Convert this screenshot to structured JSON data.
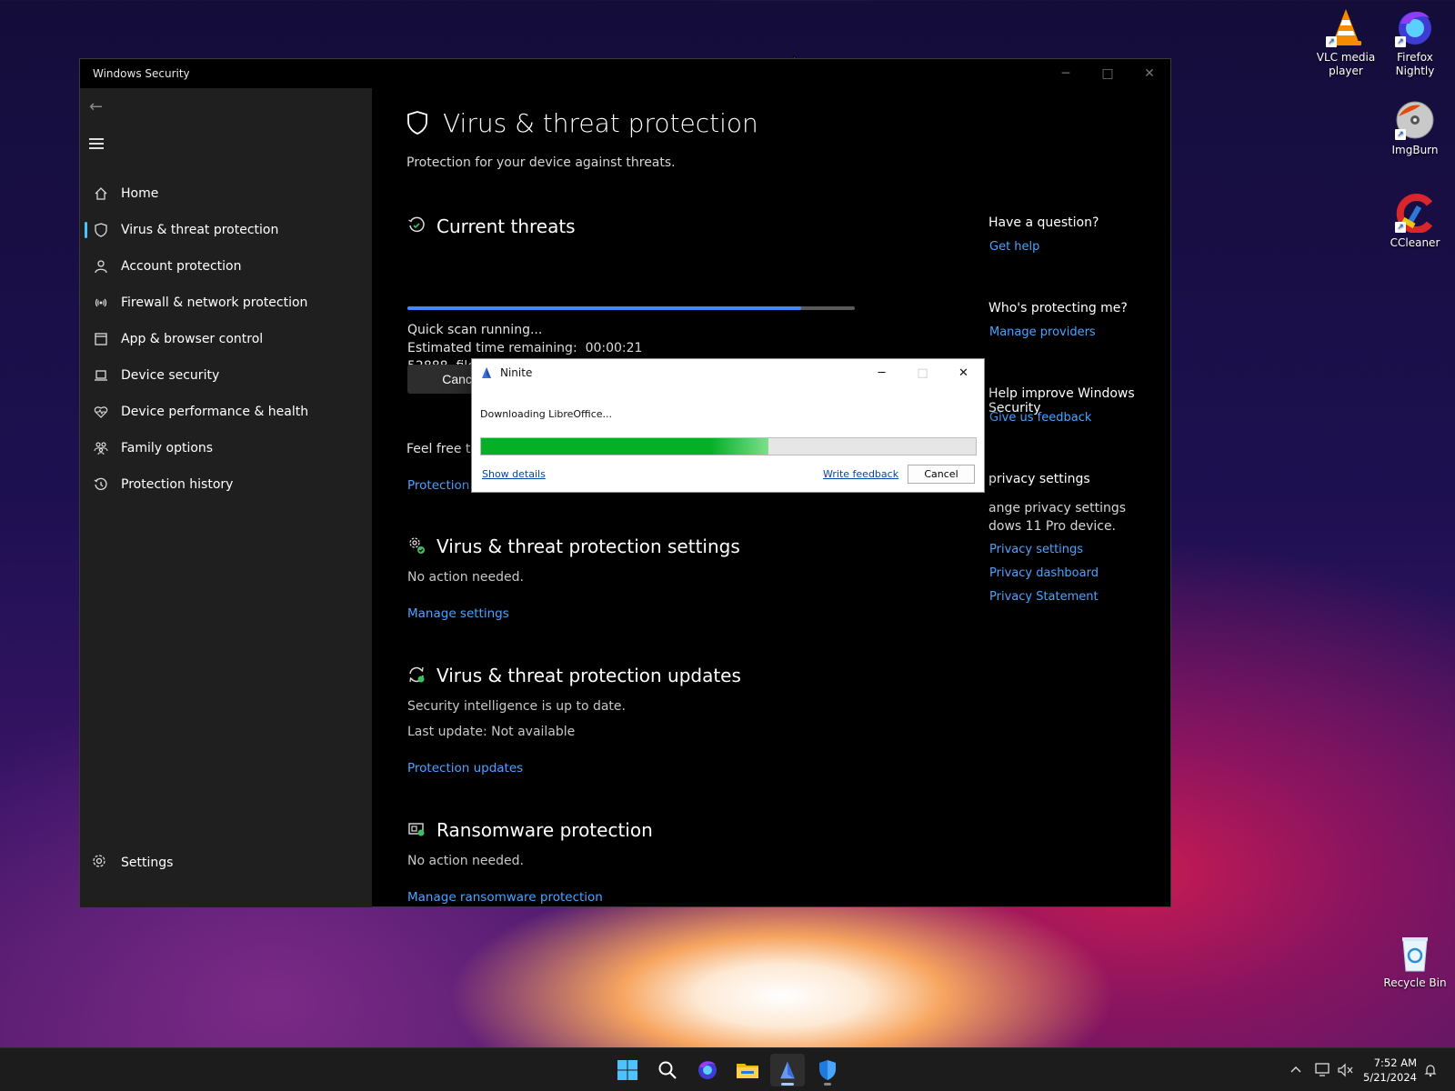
{
  "desktop": {
    "icons": [
      {
        "label": "VLC media player"
      },
      {
        "label": "Firefox Nightly"
      },
      {
        "label": "ImgBurn"
      },
      {
        "label": "CCleaner"
      },
      {
        "label": "Recycle Bin"
      }
    ]
  },
  "window": {
    "title": "Windows Security",
    "controls": {
      "minimize": "─",
      "maximize": "□",
      "close": "✕"
    }
  },
  "sidebar": {
    "items": [
      {
        "label": "Home",
        "icon": "home-icon"
      },
      {
        "label": "Virus & threat protection",
        "icon": "shield-icon"
      },
      {
        "label": "Account protection",
        "icon": "person-icon"
      },
      {
        "label": "Firewall & network protection",
        "icon": "antenna-icon"
      },
      {
        "label": "App & browser control",
        "icon": "app-window-icon"
      },
      {
        "label": "Device security",
        "icon": "laptop-icon"
      },
      {
        "label": "Device performance & health",
        "icon": "heart-icon"
      },
      {
        "label": "Family options",
        "icon": "family-icon"
      },
      {
        "label": "Protection history",
        "icon": "history-icon"
      }
    ],
    "settings": "Settings"
  },
  "main": {
    "title": "Virus & threat protection",
    "subtitle": "Protection for your device against threats.",
    "current_threats": {
      "title": "Current threats",
      "scan_progress": 0.88,
      "status": "Quick scan running...",
      "eta_label": "Estimated time remaining:",
      "eta": "00:00:21",
      "files_count": "52888",
      "files_label": "files scanned",
      "cancel": "Cancel",
      "feel_free": "Feel free to",
      "protection_link": "Protection"
    },
    "settings_section": {
      "title": "Virus & threat protection settings",
      "status": "No action needed.",
      "link": "Manage settings"
    },
    "updates_section": {
      "title": "Virus & threat protection updates",
      "status": "Security intelligence is up to date.",
      "last_update": "Last update: Not available",
      "link": "Protection updates"
    },
    "ransomware_section": {
      "title": "Ransomware protection",
      "status": "No action needed.",
      "link": "Manage ransomware protection"
    }
  },
  "right_panel": {
    "question": "Have a question?",
    "get_help": "Get help",
    "who": "Who's protecting me?",
    "manage_providers": "Manage providers",
    "help_improve": "Help improve Windows Security",
    "give_feedback": "Give us feedback",
    "privacy_heading": "privacy settings",
    "privacy_line1": "ange privacy settings",
    "privacy_line2": "dows 11 Pro device.",
    "privacy_settings": "Privacy settings",
    "privacy_dashboard": "Privacy dashboard",
    "privacy_statement": "Privacy Statement"
  },
  "ninite": {
    "title": "Ninite",
    "status": "Downloading LibreOffice...",
    "progress": 0.58,
    "show_details": "Show details",
    "write_feedback": "Write feedback",
    "cancel": "Cancel"
  },
  "taskbar": {
    "time": "7:52 AM",
    "date": "5/21/2024"
  },
  "colors": {
    "accent_link": "#4ba3ff",
    "scan_bar": "#3c8cff",
    "ninite_green": "#06b025"
  }
}
